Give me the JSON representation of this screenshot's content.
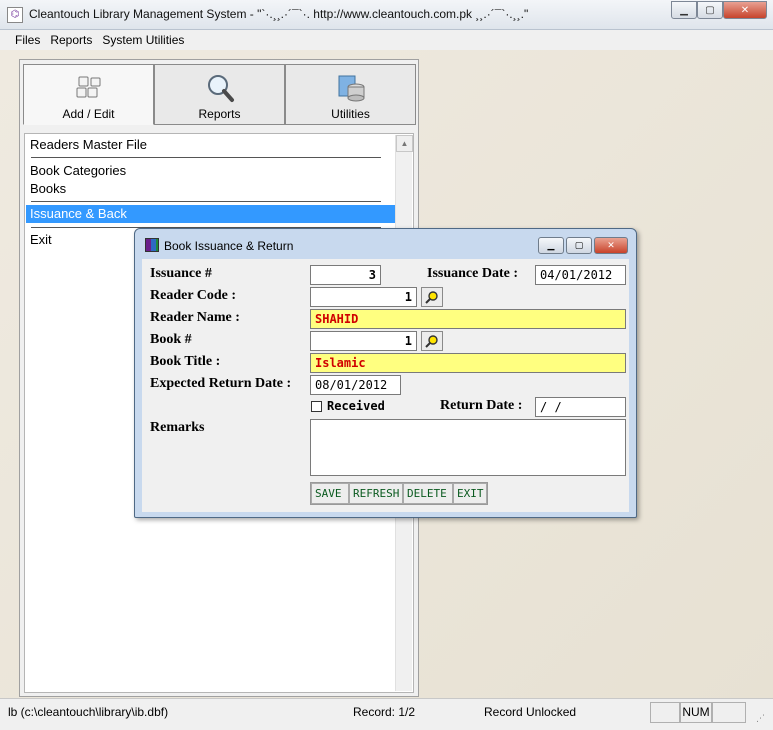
{
  "window": {
    "title": "Cleantouch Library Management System  -  \"`·.¸¸.·´¯`·. http://www.cleantouch.com.pk ¸¸.·´¯`·.¸¸.\"",
    "minimize_icon": "minimize-icon",
    "maximize_icon": "maximize-icon",
    "close_icon": "close-icon"
  },
  "menu": {
    "files": "Files",
    "reports": "Reports",
    "system_utilities": "System Utilities"
  },
  "toolbar": {
    "buttons": [
      {
        "label": "Add / Edit",
        "icon": "keyboard-icon"
      },
      {
        "label": "Reports",
        "icon": "magnifier-icon"
      },
      {
        "label": "Utilities",
        "icon": "database-icon"
      }
    ]
  },
  "sidebar": {
    "items": [
      {
        "label": "Readers Master File"
      },
      {
        "label": "Book Categories"
      },
      {
        "label": "Books"
      },
      {
        "label": "Issuance & Back"
      },
      {
        "label": "Exit"
      }
    ],
    "selected": "Issuance & Back"
  },
  "dialog": {
    "title": "Book Issuance & Return",
    "labels": {
      "issuance_no": "Issuance #",
      "issuance_date": "Issuance Date :",
      "reader_code": "Reader Code :",
      "reader_name": "Reader Name :",
      "book_no": "Book #",
      "book_title": "Book Title :",
      "expected_return": "Expected Return Date :",
      "received": "Received",
      "return_date": "Return Date :",
      "remarks": "Remarks"
    },
    "values": {
      "issuance_no": "3",
      "issuance_date": "04/01/2012",
      "reader_code": "1",
      "reader_name": "SHAHID",
      "book_no": "1",
      "book_title": "Islamic",
      "expected_return": "08/01/2012",
      "received": false,
      "return_date": " /  /",
      "remarks": ""
    },
    "buttons": {
      "save": "SAVE",
      "refresh": "REFRESH",
      "delete": "DELETE",
      "exit": "EXIT"
    }
  },
  "status": {
    "file": "lb (c:\\cleantouch\\library\\ib.dbf)",
    "record": "Record: 1/2",
    "lock": "Record Unlocked",
    "num": "NUM"
  }
}
